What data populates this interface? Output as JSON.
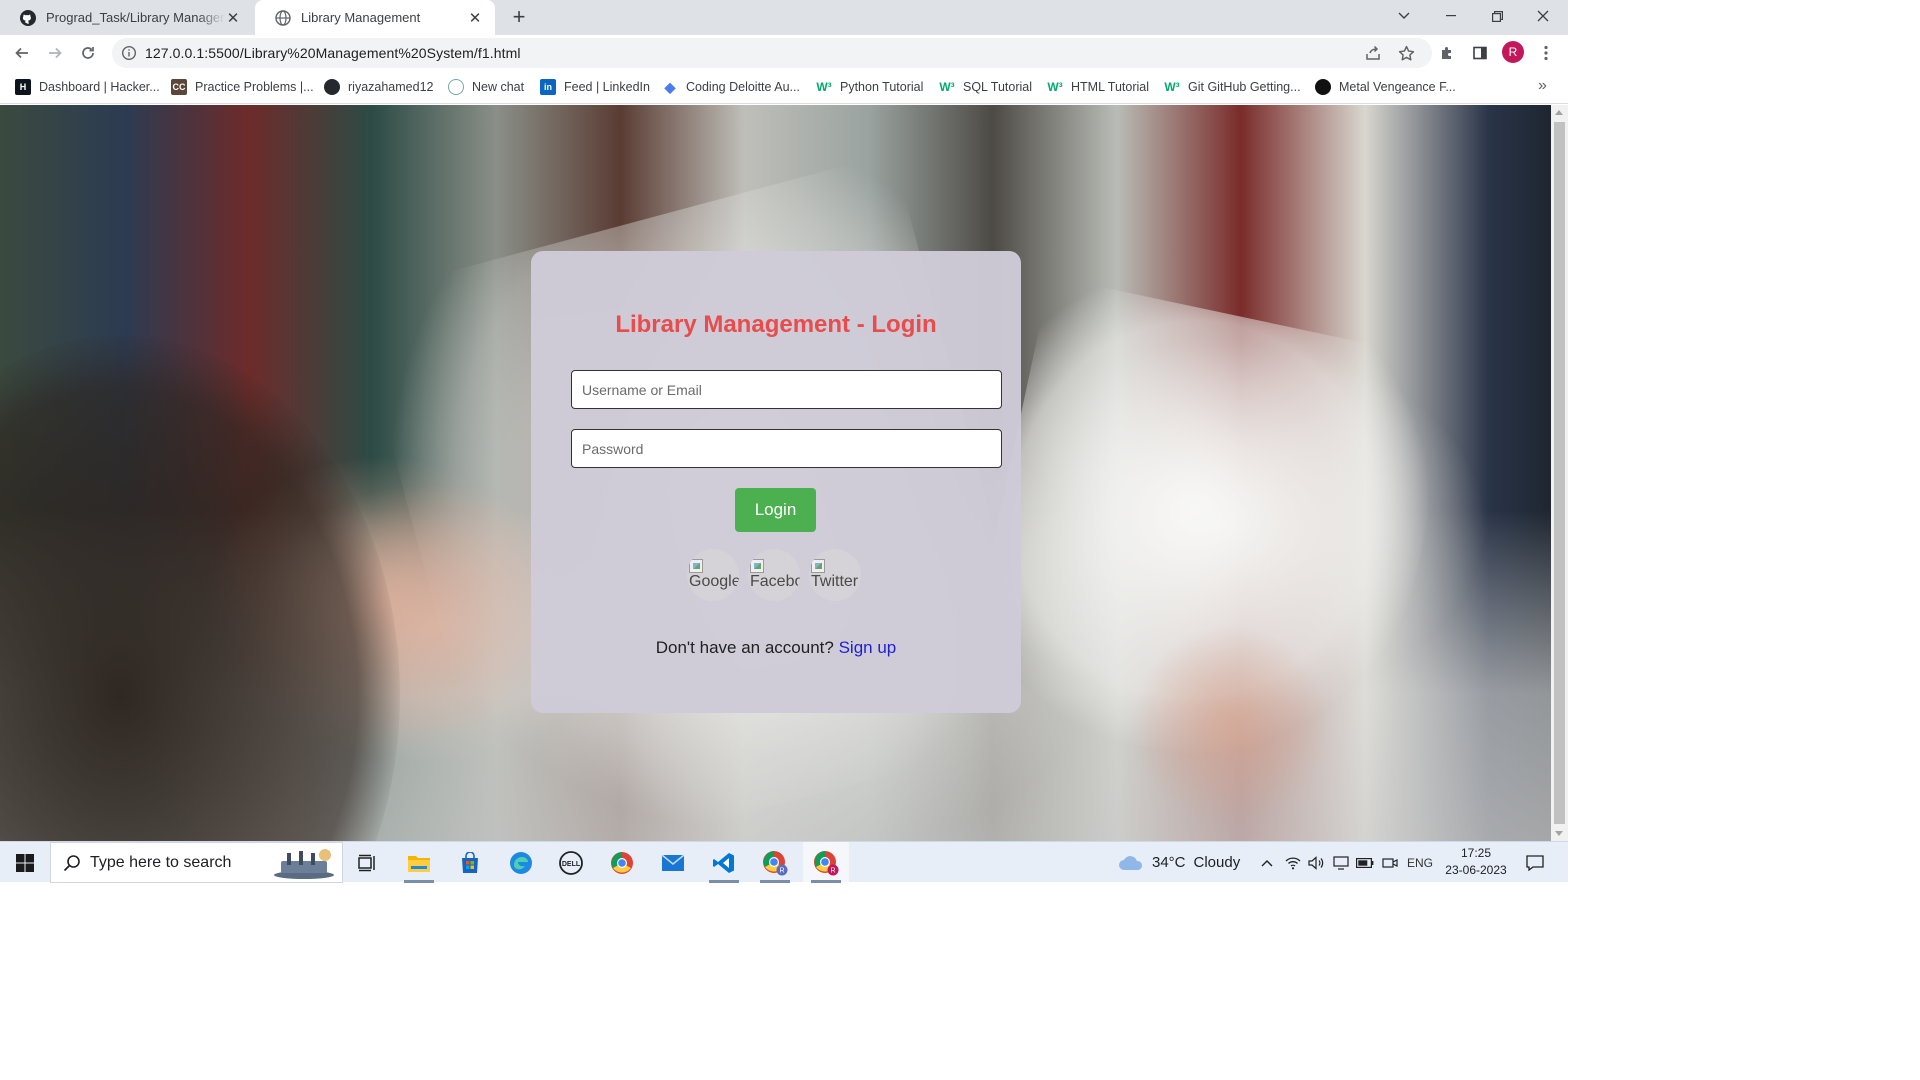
{
  "browser": {
    "tabs": [
      {
        "title": "Prograd_Task/Library Manageme",
        "favicon": "github-icon"
      },
      {
        "title": "Library Management",
        "favicon": "globe-icon"
      }
    ],
    "url": "127.0.0.1:5500/Library%20Management%20System/f1.html",
    "profile_initial": "R",
    "bookmarks": [
      {
        "label": "Dashboard | Hacker...",
        "icon": "hackerrank-icon"
      },
      {
        "label": "Practice Problems |...",
        "icon": "codechef-icon"
      },
      {
        "label": "riyazahamed12",
        "icon": "github-icon"
      },
      {
        "label": "New chat",
        "icon": "chatgpt-icon"
      },
      {
        "label": "Feed | LinkedIn",
        "icon": "linkedin-icon"
      },
      {
        "label": "Coding Deloitte Au...",
        "icon": "diamond-icon"
      },
      {
        "label": "Python Tutorial",
        "icon": "w3schools-icon"
      },
      {
        "label": "SQL Tutorial",
        "icon": "w3schools-icon"
      },
      {
        "label": "HTML Tutorial",
        "icon": "w3schools-icon"
      },
      {
        "label": "Git GitHub Getting...",
        "icon": "w3schools-icon"
      },
      {
        "label": "Metal Vengeance F...",
        "icon": "game-icon"
      }
    ],
    "more_bookmarks": "»"
  },
  "login": {
    "title": "Library Management - Login",
    "username_placeholder": "Username or Email",
    "password_placeholder": "Password",
    "login_button": "Login",
    "social": [
      {
        "alt": "Google"
      },
      {
        "alt": "Facebook"
      },
      {
        "alt": "Twitter"
      }
    ],
    "signup_prompt": "Don't have an account?",
    "signup_link": "Sign up"
  },
  "taskbar": {
    "search_placeholder": "Type here to search",
    "weather_temp": "34°C",
    "weather_desc": "Cloudy",
    "language": "ENG",
    "time": "17:25",
    "date": "23-06-2023"
  },
  "colors": {
    "title_red": "#e84c4c",
    "login_green": "#4caf50",
    "card_bg": "#cecbd8",
    "link_blue": "#1f1fd6"
  }
}
